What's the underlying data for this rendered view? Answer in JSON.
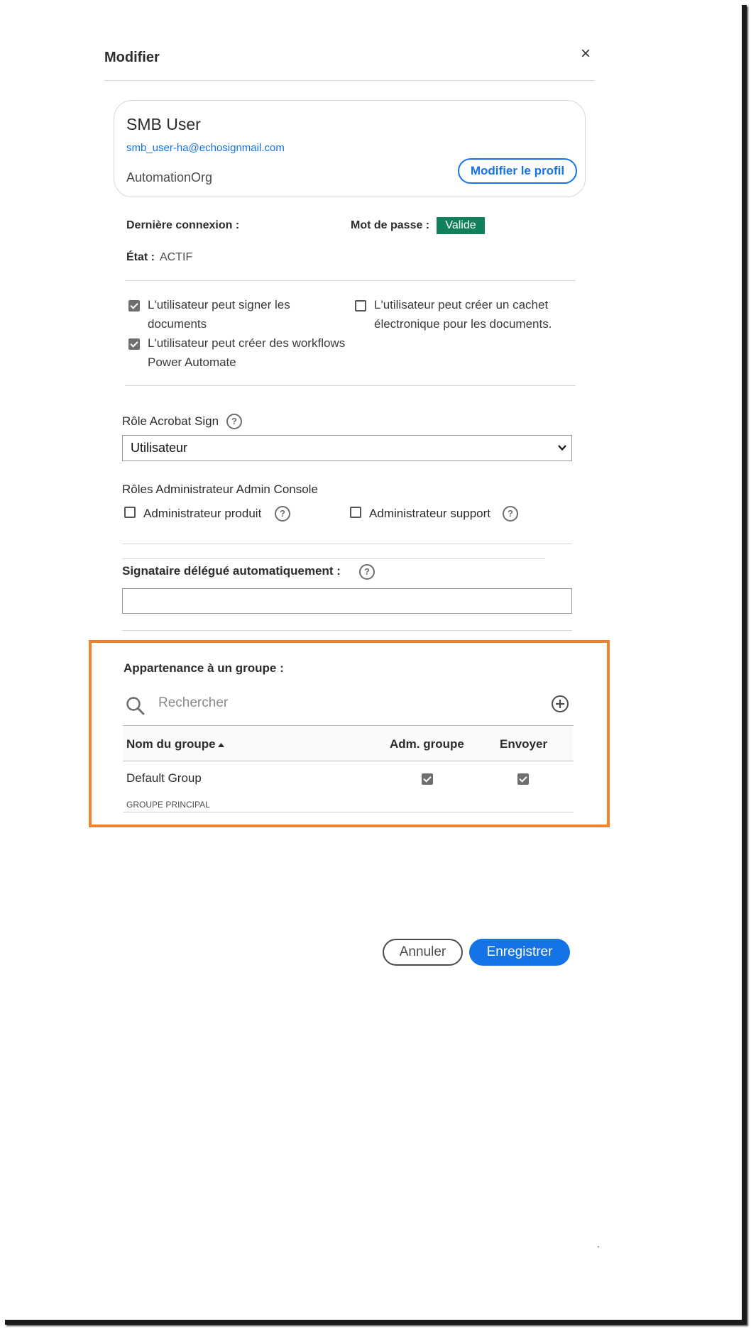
{
  "dialog": {
    "title": "Modifier",
    "close_symbol": "×"
  },
  "profile": {
    "name": "SMB User",
    "email": "smb_user-ha@echosignmail.com",
    "org": "AutomationOrg",
    "edit_profile_label": "Modifier le profil"
  },
  "status": {
    "last_login_label": "Dernière connexion :",
    "password_label": "Mot de passe :",
    "password_status": "Valide",
    "password_status_color": "#12805c",
    "state_label": "État :",
    "state_value": "ACTIF"
  },
  "permissions": [
    {
      "line1": "L'utilisateur peut signer les",
      "line2": "documents",
      "checked": true
    },
    {
      "line1": "L'utilisateur peut créer des workflows",
      "line2": "Power Automate",
      "checked": true
    },
    {
      "line1": "L'utilisateur peut créer un cachet",
      "line2": "électronique pour les documents.",
      "checked": false
    }
  ],
  "role": {
    "label": "Rôle Acrobat Sign",
    "selected": "Utilisateur",
    "help_icon": "question-circle-icon"
  },
  "admin_roles": {
    "label": "Rôles Administrateur Admin Console",
    "items": [
      {
        "label": "Administrateur produit",
        "checked": false
      },
      {
        "label": "Administrateur support",
        "checked": false
      }
    ]
  },
  "delegate": {
    "label": "Signataire délégué automatiquement :",
    "value": ""
  },
  "groups": {
    "label": "Appartenance à un groupe :",
    "search_placeholder": "Rechercher",
    "columns": [
      "Nom du groupe",
      "Adm. groupe",
      "Envoyer"
    ],
    "rows": [
      {
        "name": "Default Group",
        "tag": "GROUPE PRINCIPAL",
        "group_admin": true,
        "send": true
      }
    ],
    "highlight_color": "#f0832e"
  },
  "footer": {
    "cancel_label": "Annuler",
    "save_label": "Enregistrer",
    "accent": "#1473e6"
  },
  "stray_mark": "."
}
